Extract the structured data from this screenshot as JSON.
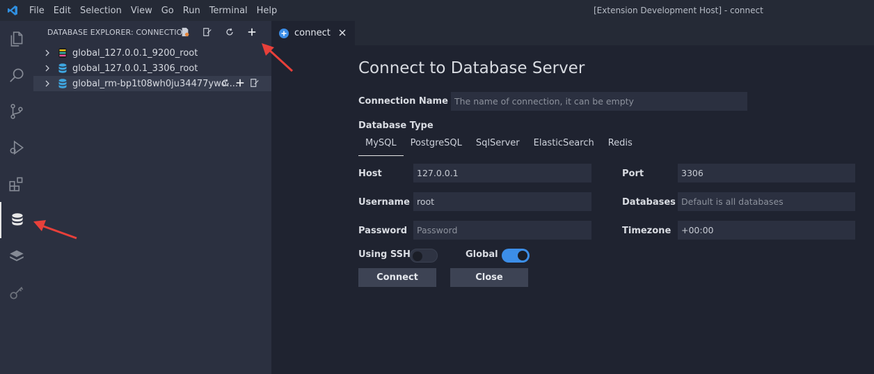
{
  "titlebar": {
    "menu": [
      "File",
      "Edit",
      "Selection",
      "View",
      "Go",
      "Run",
      "Terminal",
      "Help"
    ],
    "window_title": "[Extension Development Host] - connect"
  },
  "activity_bar": {
    "icons": [
      "explorer-icon",
      "search-icon",
      "source-control-icon",
      "run-debug-icon",
      "extensions-icon",
      "database-icon",
      "layers-icon",
      "key-icon"
    ],
    "active": "database-icon"
  },
  "sidebar": {
    "header": "DATABASE EXPLORER: CONNECTIO...",
    "actions": [
      "new-query-icon",
      "edit-file-icon",
      "refresh-icon",
      "add-icon"
    ],
    "items": [
      {
        "label": "global_127.0.0.1_9200_root",
        "icon": "elasticsearch-icon"
      },
      {
        "label": "global_127.0.0.1_3306_root",
        "icon": "database-icon"
      },
      {
        "label": "global_rm-bp1t08wh0ju34477ywo....",
        "icon": "database-icon"
      }
    ]
  },
  "editor": {
    "tab_label": "connect",
    "title": "Connect to Database Server",
    "connection_name_label": "Connection Name",
    "connection_name_placeholder": "The name of connection, it can be empty",
    "database_type_label": "Database Type",
    "db_types": [
      "MySQL",
      "PostgreSQL",
      "SqlServer",
      "ElasticSearch",
      "Redis"
    ],
    "selected_db_type": "MySQL",
    "host_label": "Host",
    "host_value": "127.0.0.1",
    "port_label": "Port",
    "port_value": "3306",
    "username_label": "Username",
    "username_value": "root",
    "databases_label": "Databases",
    "databases_placeholder": "Default is all databases",
    "password_label": "Password",
    "password_placeholder": "Password",
    "timezone_label": "Timezone",
    "timezone_value": "+00:00",
    "using_ssh_label": "Using SSH",
    "using_ssh_on": false,
    "global_label": "Global",
    "global_on": true,
    "connect_button": "Connect",
    "close_button": "Close"
  },
  "colors": {
    "accent": "#3c8ee8",
    "annotation": "#e8403a"
  }
}
